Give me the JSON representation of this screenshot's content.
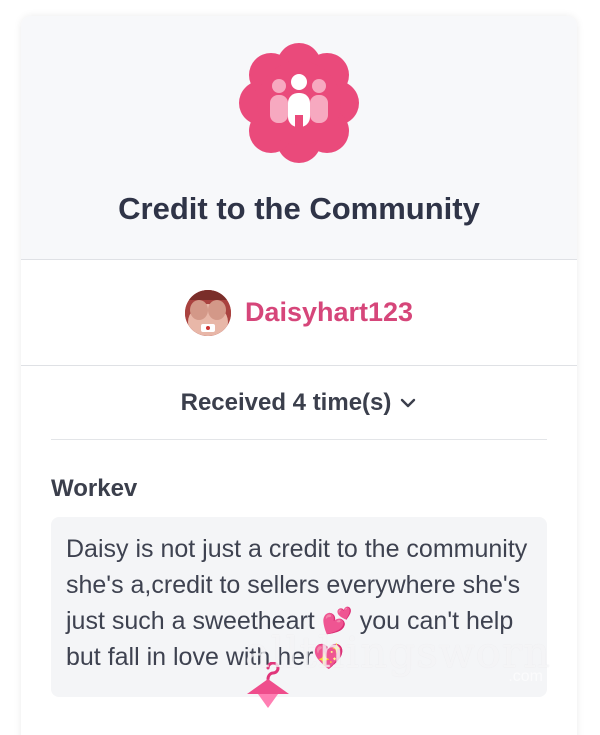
{
  "badge": {
    "title": "Credit to the Community",
    "icon": "community-people-icon",
    "icon_color": "#ea4a7b"
  },
  "user": {
    "name": "Daisyhart123",
    "avatar": "avatar",
    "name_color": "#d6467a"
  },
  "received": {
    "label": "Received 4 time(s)",
    "icon": "chevron-down-icon"
  },
  "review": {
    "author": "Workev",
    "text": "Daisy is not just a credit to the community she's a,credit to sellers everywhere she's just such a sweetheart 💕 you can't help but fall in love with her💖"
  },
  "watermark": {
    "text": "allthingsworn",
    "sub": ".com",
    "logo": "pink-hanger-icon"
  }
}
